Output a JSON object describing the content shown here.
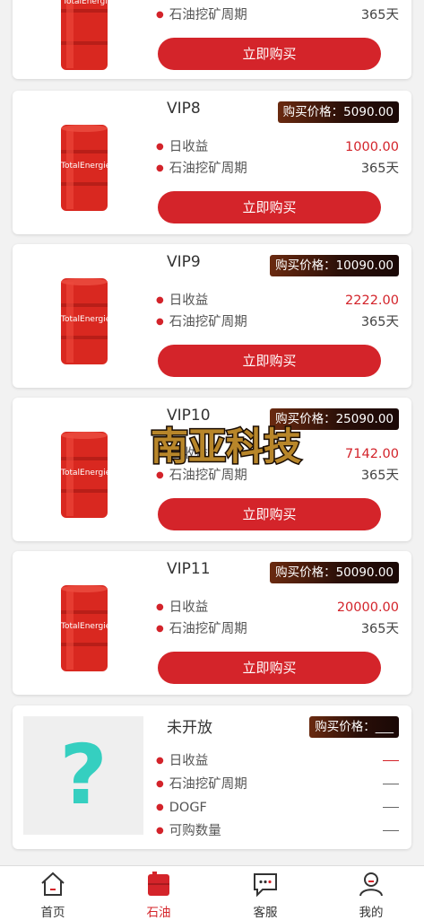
{
  "products": [
    {
      "id": "vip7",
      "name": "",
      "price_label": "",
      "daily_label": "",
      "daily_value": "",
      "cycle_label": "石油挖矿周期",
      "cycle_value": "365天",
      "buy_label": "立即购买"
    },
    {
      "id": "vip8",
      "name": "VIP8",
      "price_label": "购买价格：5090.00",
      "daily_label": "日收益",
      "daily_value": "1000.00",
      "cycle_label": "石油挖矿周期",
      "cycle_value": "365天",
      "buy_label": "立即购买"
    },
    {
      "id": "vip9",
      "name": "VIP9",
      "price_label": "购买价格：10090.00",
      "daily_label": "日收益",
      "daily_value": "2222.00",
      "cycle_label": "石油挖矿周期",
      "cycle_value": "365天",
      "buy_label": "立即购买"
    },
    {
      "id": "vip10",
      "name": "VIP10",
      "price_label": "购买价格：25090.00",
      "daily_label": "日收益",
      "daily_value": "7142.00",
      "cycle_label": "石油挖矿周期",
      "cycle_value": "365天",
      "buy_label": "立即购买"
    },
    {
      "id": "vip11",
      "name": "VIP11",
      "price_label": "购买价格：50090.00",
      "daily_label": "日收益",
      "daily_value": "20000.00",
      "cycle_label": "石油挖矿周期",
      "cycle_value": "365天",
      "buy_label": "立即购买"
    }
  ],
  "unopened": {
    "name": "未开放",
    "price_label": "购买价格：___",
    "rows": [
      "日收益",
      "石油挖矿周期",
      "DOGF",
      "可购数量"
    ]
  },
  "barrel_brand": "TotalEnergies",
  "watermark": "南亚科技",
  "tabs": [
    {
      "label": "首页",
      "icon": "home-icon"
    },
    {
      "label": "石油",
      "icon": "oil-barrel-icon"
    },
    {
      "label": "客服",
      "icon": "chat-icon"
    },
    {
      "label": "我的",
      "icon": "user-icon"
    }
  ],
  "colors": {
    "accent": "#d4242a",
    "price_badge": "#2a0f08",
    "question_mark": "#35cfc0"
  }
}
